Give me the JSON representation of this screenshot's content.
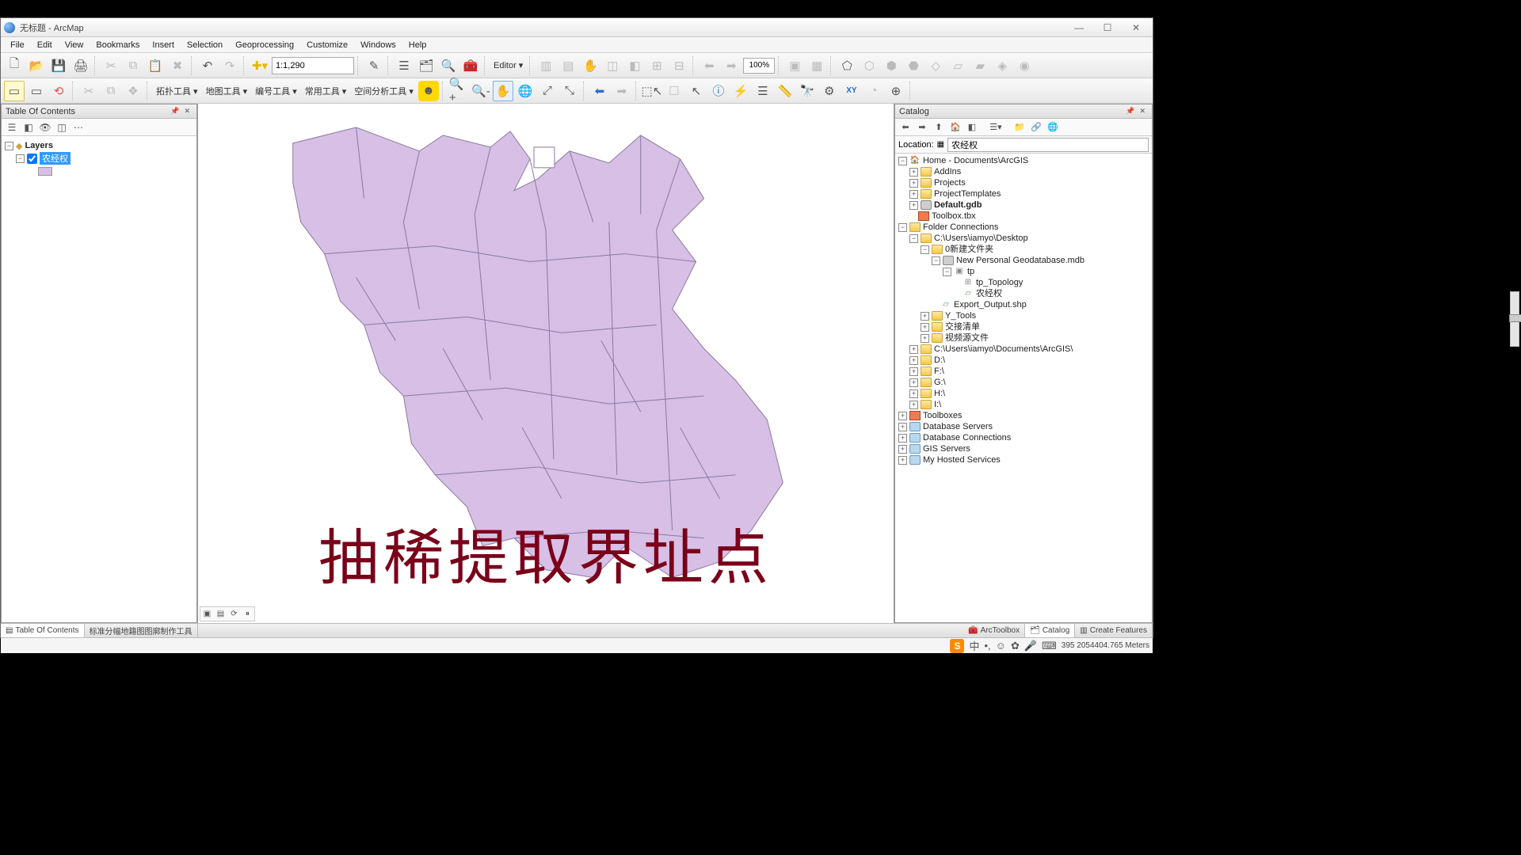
{
  "window": {
    "title": "无标题 - ArcMap"
  },
  "menu": [
    "File",
    "Edit",
    "View",
    "Bookmarks",
    "Insert",
    "Selection",
    "Geoprocessing",
    "Customize",
    "Windows",
    "Help"
  ],
  "toolbar1": {
    "scale": "1:1,290",
    "editor": "Editor ▾",
    "zoom_pct": "100%"
  },
  "toolbar2": {
    "groups": [
      "拓扑工具 ▾",
      "地图工具 ▾",
      "编号工具 ▾",
      "常用工具 ▾",
      "空间分析工具 ▾"
    ],
    "xy_label": "XY"
  },
  "toc": {
    "title": "Table Of Contents",
    "root": "Layers",
    "layer": "农经权"
  },
  "map_overlay": "抽稀提取界址点",
  "catalog": {
    "title": "Catalog",
    "location_label": "Location:",
    "location": "农经权",
    "tree": {
      "home": "Home - Documents\\ArcGIS",
      "addins": "AddIns",
      "projects": "Projects",
      "ptemplates": "ProjectTemplates",
      "defgdb": "Default.gdb",
      "toolbox": "Toolbox.tbx",
      "fc": "Folder Connections",
      "desktop": "C:\\Users\\iamyo\\Desktop",
      "newfolder": "0新建文件夹",
      "pgdb": "New Personal Geodatabase.mdb",
      "tp": "tp",
      "tp_topo": "tp_Topology",
      "tp_layer": "农经权",
      "export": "Export_Output.shp",
      "ytools": "Y_Tools",
      "jjqd": "交接清单",
      "spywj": "视频源文件",
      "docs": "C:\\Users\\iamyo\\Documents\\ArcGIS\\",
      "d": "D:\\",
      "f": "F:\\",
      "g": "G:\\",
      "h": "H:\\",
      "i": "I:\\",
      "toolboxes": "Toolboxes",
      "dbs": "Database Servers",
      "dbc": "Database Connections",
      "gis": "GIS Servers",
      "mhs": "My Hosted Services"
    }
  },
  "bottom_tabs": {
    "toc": "Table Of Contents",
    "other": "标准分幅地籍图图廓制作工具",
    "arctool": "ArcToolbox",
    "catalog": "Catalog",
    "createfeat": "Create Features"
  },
  "status": {
    "ime_lang": "中",
    "coords": "395  2054404.765 Meters"
  }
}
